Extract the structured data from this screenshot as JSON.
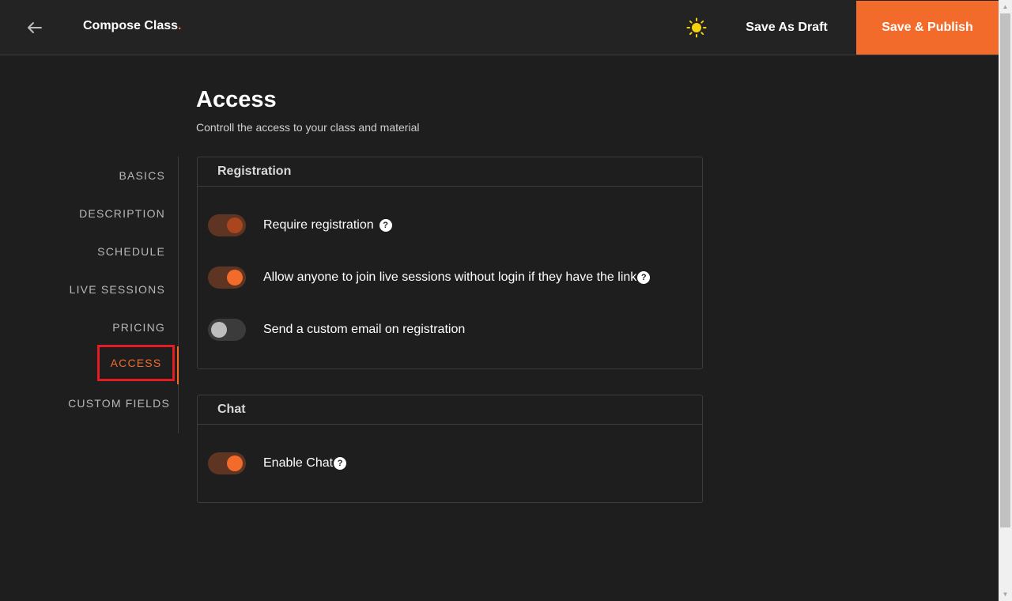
{
  "header": {
    "title": "Compose Class",
    "title_dot": ".",
    "back_icon": "arrow-left-icon",
    "theme_icon": "sun-icon",
    "save_draft_label": "Save As Draft",
    "publish_label": "Save & Publish",
    "accent_color": "#f26b2a"
  },
  "page": {
    "heading": "Access",
    "subtitle": "Controll the access to your class and material"
  },
  "sidenav": {
    "items": [
      {
        "label": "BASICS"
      },
      {
        "label": "DESCRIPTION"
      },
      {
        "label": "SCHEDULE"
      },
      {
        "label": "LIVE SESSIONS"
      },
      {
        "label": "PRICING"
      },
      {
        "label": "ACCESS",
        "active": true
      },
      {
        "label": "CUSTOM FIELDS"
      }
    ]
  },
  "registration": {
    "title": "Registration",
    "options": [
      {
        "label": "Require registration",
        "state": "on",
        "help": "?"
      },
      {
        "label": "Allow anyone to join live sessions without login if they have the link",
        "state": "on",
        "help": "?"
      },
      {
        "label": "Send a custom email on registration",
        "state": "off"
      }
    ]
  },
  "chat": {
    "title": "Chat",
    "options": [
      {
        "label": "Enable Chat",
        "state": "on",
        "help": "?"
      }
    ]
  }
}
